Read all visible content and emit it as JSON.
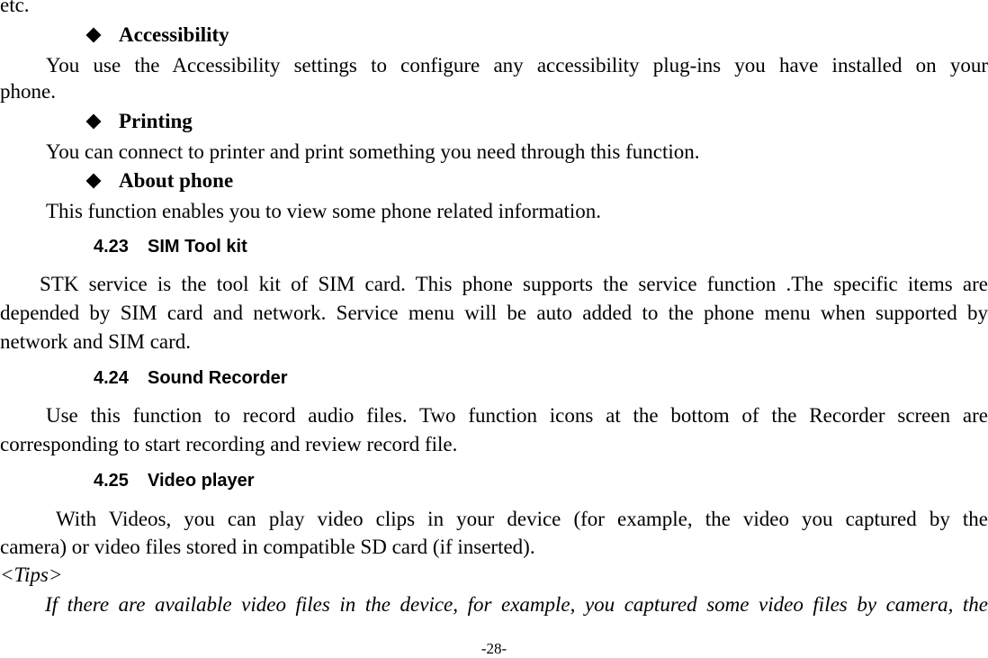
{
  "page": {
    "lines": {
      "etc": "etc.",
      "accessibility_heading": "Accessibility",
      "accessibility_l1": "You use the Accessibility settings to configure any accessibility plug-ins you have installed on your",
      "accessibility_l2": "phone.",
      "printing_heading": "Printing",
      "printing_l1": "You can connect to printer and print something you need through this function.",
      "about_heading": "About phone",
      "about_l1": "This function enables you to view some phone related information."
    },
    "sections": [
      {
        "number": "4.23",
        "title": "SIM Tool kit",
        "lines": [
          "STK service is the tool kit of SIM card. This phone supports the service function .The specific items are",
          "depended by SIM card and network. Service menu will be auto added to the phone menu when supported by",
          "network and SIM card."
        ]
      },
      {
        "number": "4.24",
        "title": "Sound Recorder",
        "lines": [
          "Use this function to record audio files. Two function icons at the bottom of the Recorder screen are",
          "corresponding to start recording and review record file."
        ]
      },
      {
        "number": "4.25",
        "title": "Video player",
        "lines": [
          "With Videos, you can play video clips in your device (for example, the video you captured by the",
          "camera) or video files stored in compatible SD card (if inserted)."
        ]
      }
    ],
    "tips_label": "<Tips>",
    "tips_line": "If there are available video files in the device, for example, you captured some video files by camera, the",
    "page_number": "-28-"
  }
}
